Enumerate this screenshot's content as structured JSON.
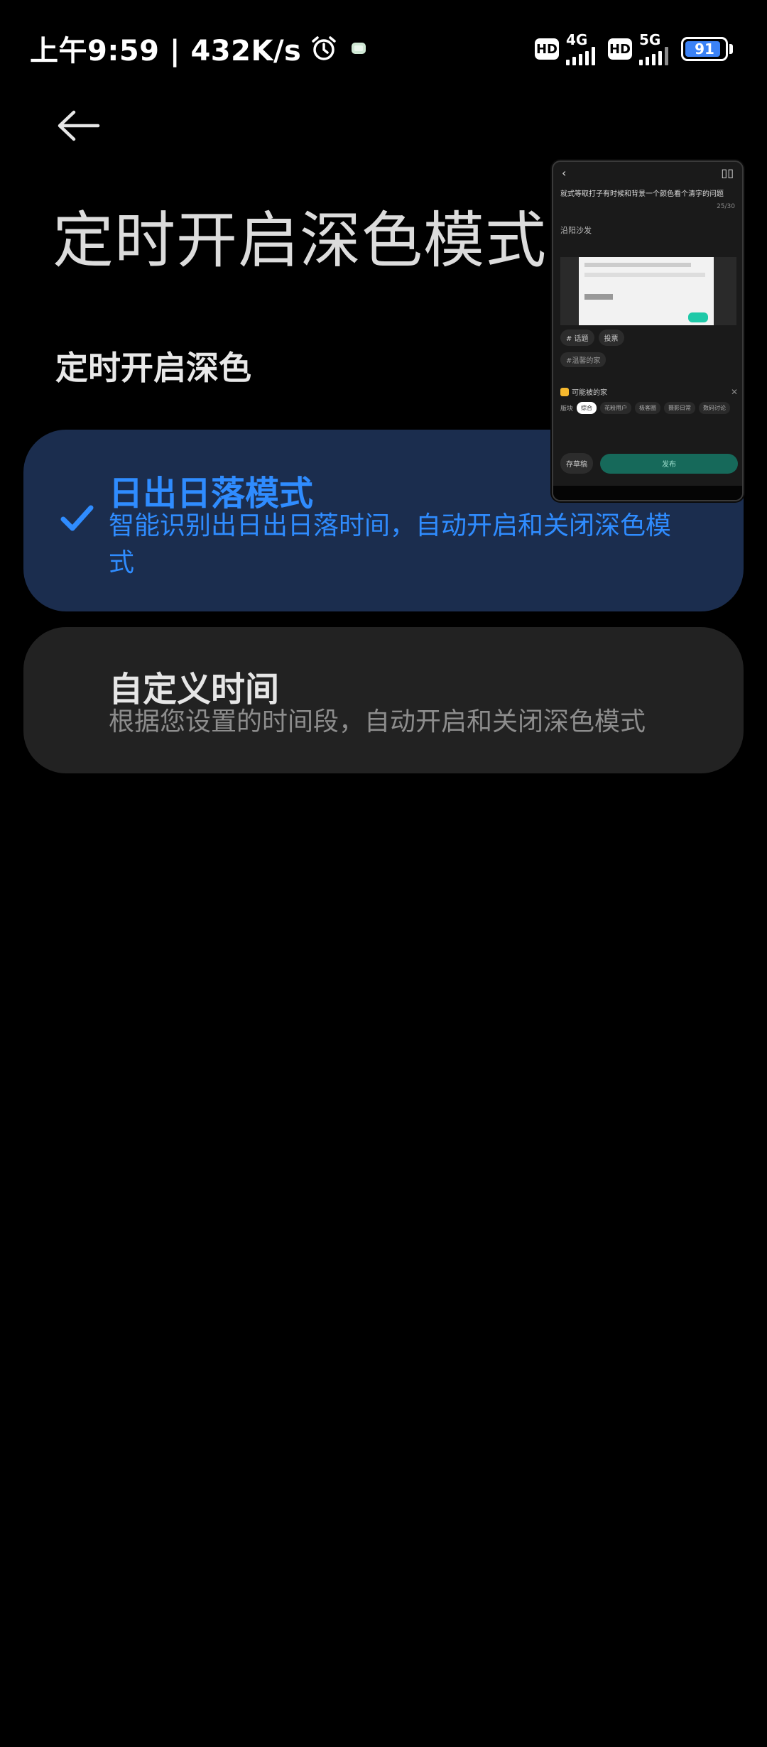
{
  "status_bar": {
    "time_text": "上午9:59 | 432K/s",
    "hd1": "HD",
    "net1": "4G",
    "hd2": "HD",
    "net2": "5G",
    "battery_level": 91,
    "battery_text": "91",
    "battery_color": "#3b82f6"
  },
  "header": {
    "back_icon": "arrow-left-icon",
    "title": "定时开启深色模式"
  },
  "section": {
    "title": "定时开启深色"
  },
  "options": [
    {
      "title": "日出日落模式",
      "description": "智能识别出日出日落时间，自动开启和关闭深色模式",
      "selected": true,
      "accent": "#2f8cff"
    },
    {
      "title": "自定义时间",
      "description": "根据您设置的时间段，自动开启和关闭深色模式",
      "selected": false
    }
  ],
  "mini_window": {
    "headline": "就式等取打子有时候和背景一个颜色看个清字的问题",
    "count": "25/30",
    "body_text": "沿阳沙发",
    "chip_topic": "# 话题",
    "chip_vote": "投票",
    "tag": "#温馨的家",
    "ai_label": "可能被的家",
    "section_label": "版块",
    "sections": [
      "综合",
      "花粉用户",
      "极客圈",
      "摄影日常",
      "数码讨论"
    ],
    "draft": "存草稿",
    "publish": "发布"
  }
}
